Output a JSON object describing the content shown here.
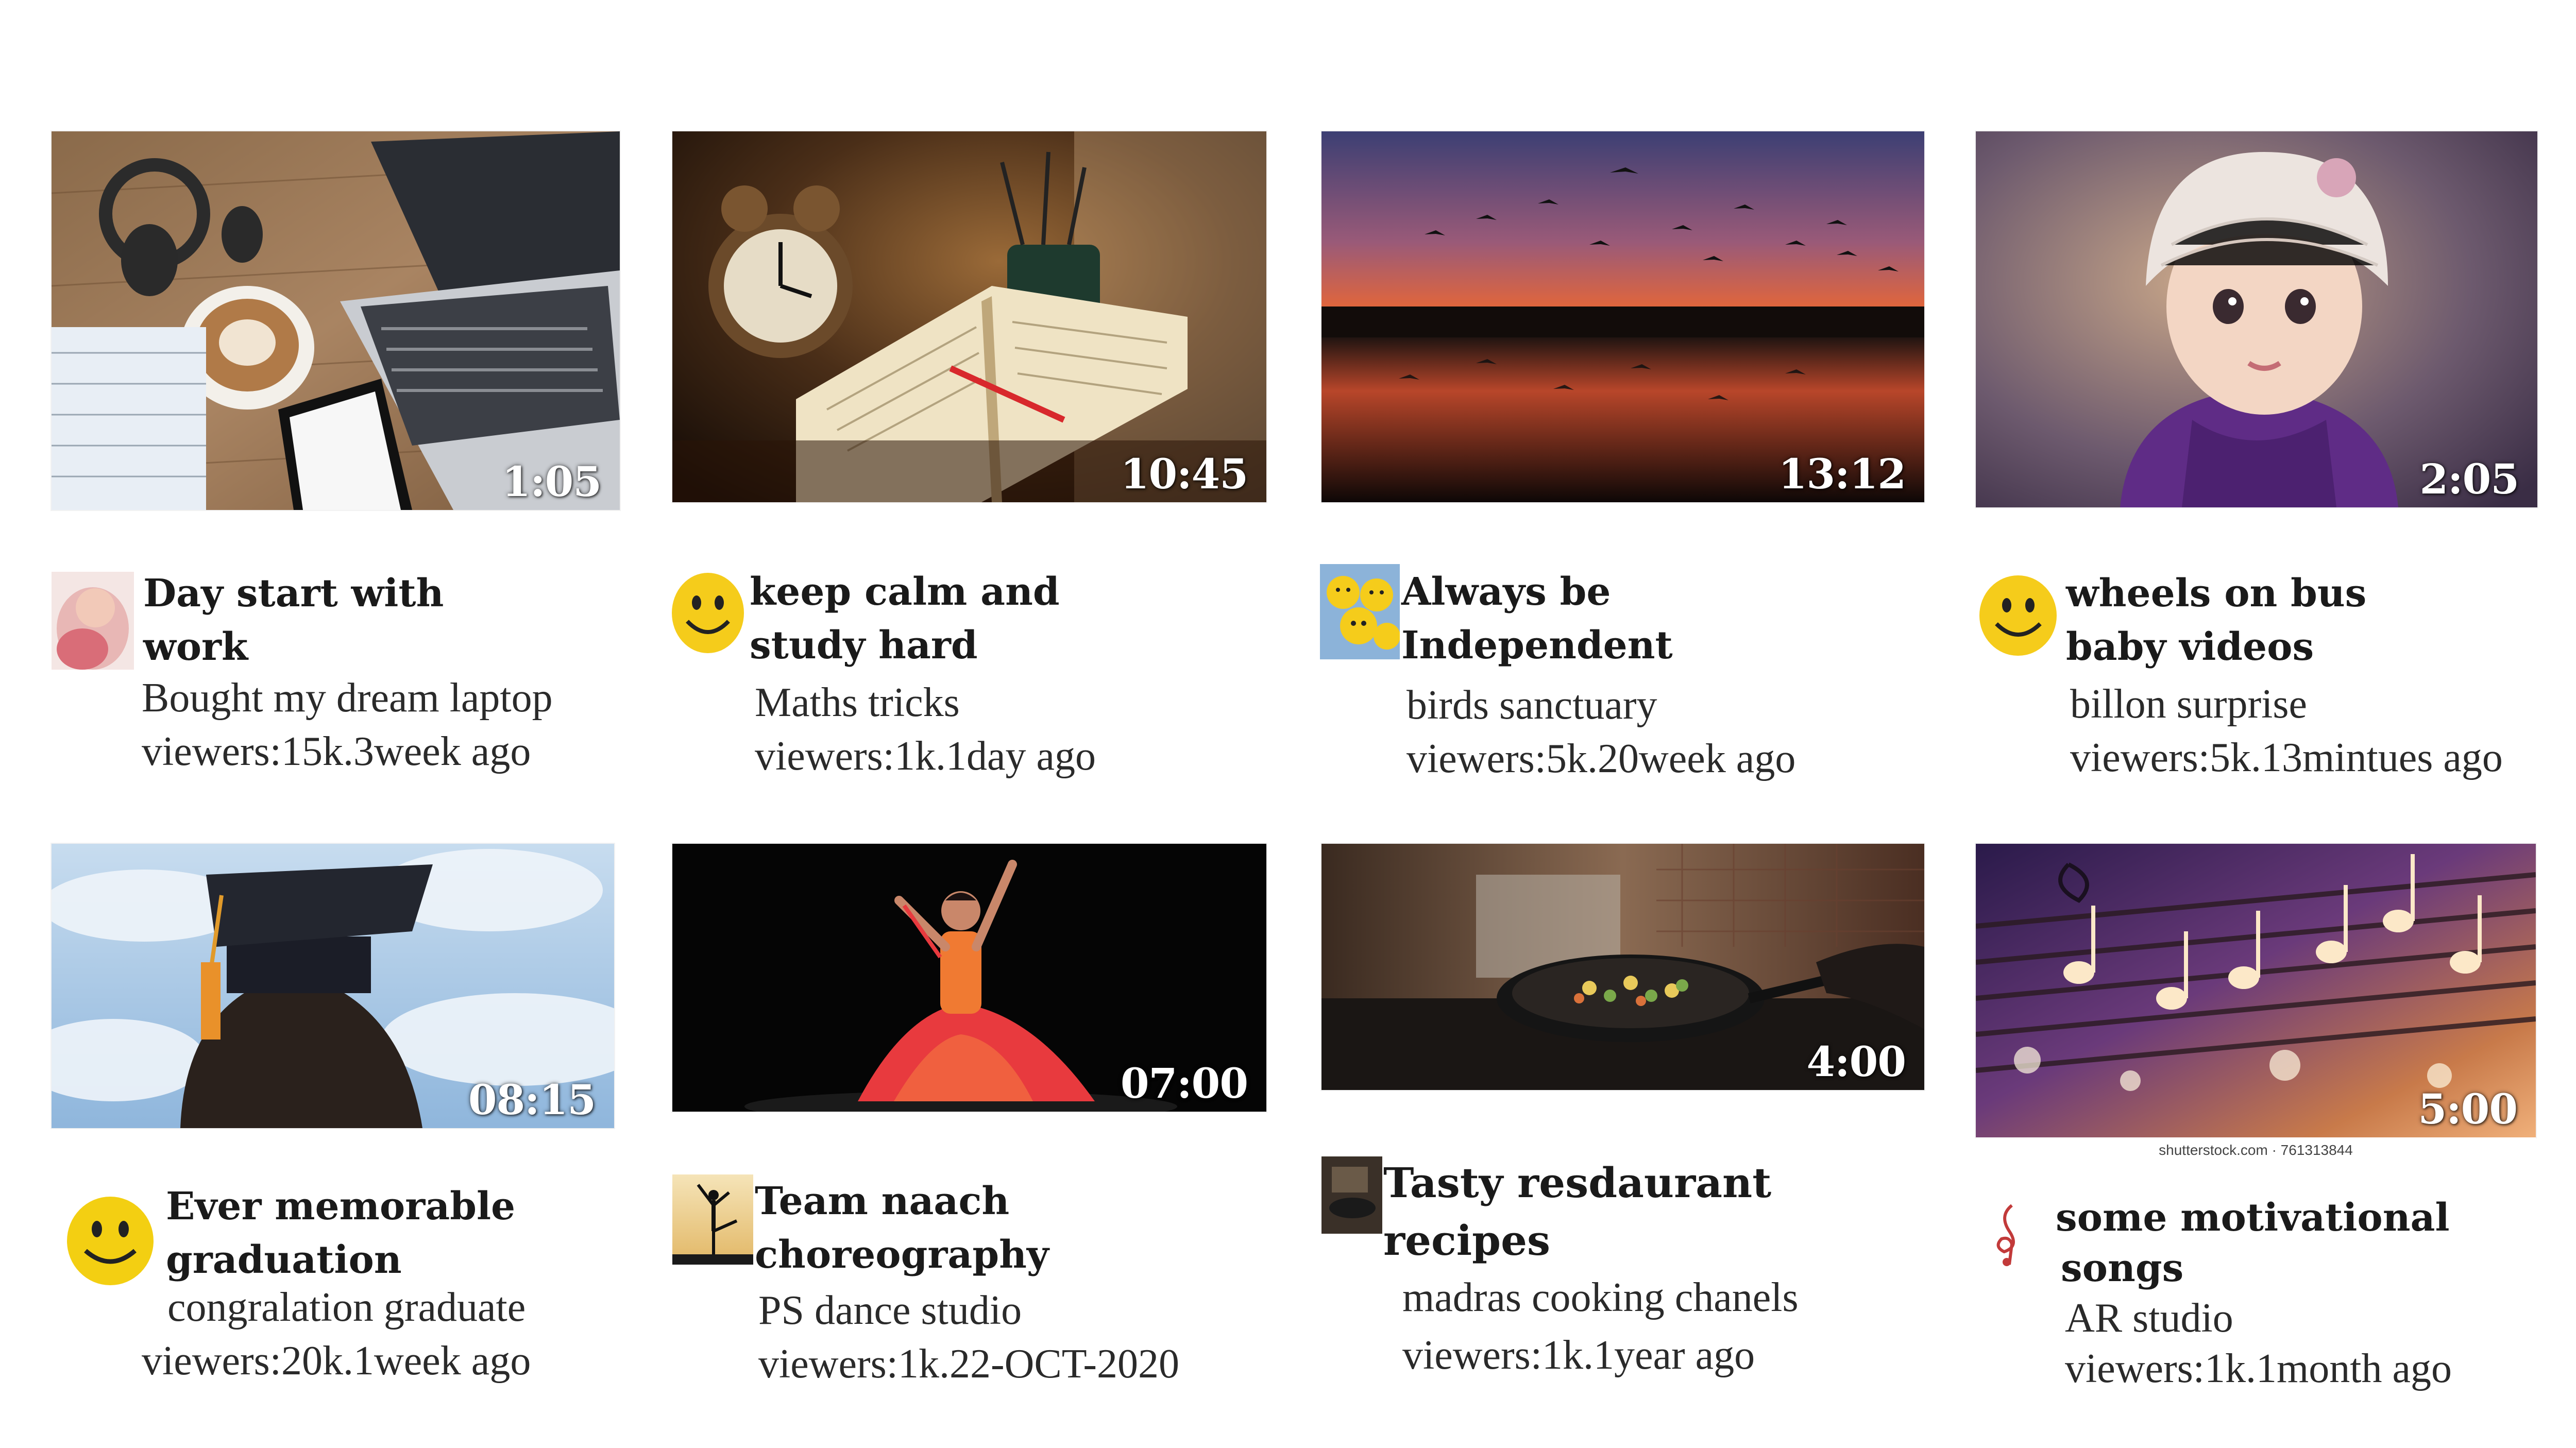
{
  "videos": [
    {
      "title_line1": "Day start with",
      "title_line2": "work",
      "channel": "Bought my dream laptop",
      "stats": "viewers:15k.3week ago",
      "duration": "1:05",
      "thumb_icon": "laptop-coffee-thumbnail",
      "avatar_icon": "baby-avatar-icon"
    },
    {
      "title_line1": "keep calm and",
      "title_line2": "study hard",
      "channel": "Maths tricks",
      "stats": "viewers:1k.1day ago",
      "duration": "10:45",
      "thumb_icon": "book-clock-thumbnail",
      "avatar_icon": "smiley-face-icon"
    },
    {
      "title_line1": "Always be",
      "title_line2": "Independent",
      "channel": "birds sanctuary",
      "stats": "viewers:5k.20week ago",
      "duration": "13:12",
      "thumb_icon": "birds-sunset-thumbnail",
      "avatar_icon": "smiley-group-icon"
    },
    {
      "title_line1": "wheels on bus",
      "title_line2": "baby videos",
      "channel": "billon surprise",
      "stats": "viewers:5k.13mintues ago",
      "duration": "2:05",
      "thumb_icon": "baby-hat-thumbnail",
      "avatar_icon": "smiley-face-icon"
    },
    {
      "title_line1": "Ever memorable",
      "title_line2": "graduation",
      "channel": "congralation graduate",
      "stats": "viewers:20k.1week ago",
      "duration": "08:15",
      "thumb_icon": "graduation-cap-thumbnail",
      "avatar_icon": "smiley-face-icon"
    },
    {
      "title_line1": "Team naach",
      "title_line2": "choreography",
      "channel": "PS dance studio",
      "stats": "viewers:1k.22-OCT-2020",
      "duration": "07:00",
      "thumb_icon": "dancer-thumbnail",
      "avatar_icon": "dancer-silhouette-icon"
    },
    {
      "title_line1": "Tasty resdaurant",
      "title_line2": "recipes",
      "channel": "madras cooking chanels",
      "stats": "viewers:1k.1year ago",
      "duration": "4:00",
      "thumb_icon": "cooking-pan-thumbnail",
      "avatar_icon": "kitchen-avatar-icon"
    },
    {
      "title_line1": "some motivational",
      "title_line2": "songs",
      "channel": "AR studio",
      "stats": "viewers:1k.1month ago",
      "duration": "5:00",
      "thumb_icon": "music-notes-thumbnail",
      "avatar_icon": "treble-clef-icon",
      "watermark": "shutterstock.com · 761313844"
    }
  ],
  "colors": {
    "duration_text": "#ffffff",
    "title_text": "#1a1a1a",
    "meta_text": "#2a2a2a",
    "page_bg": "#ffffff"
  }
}
